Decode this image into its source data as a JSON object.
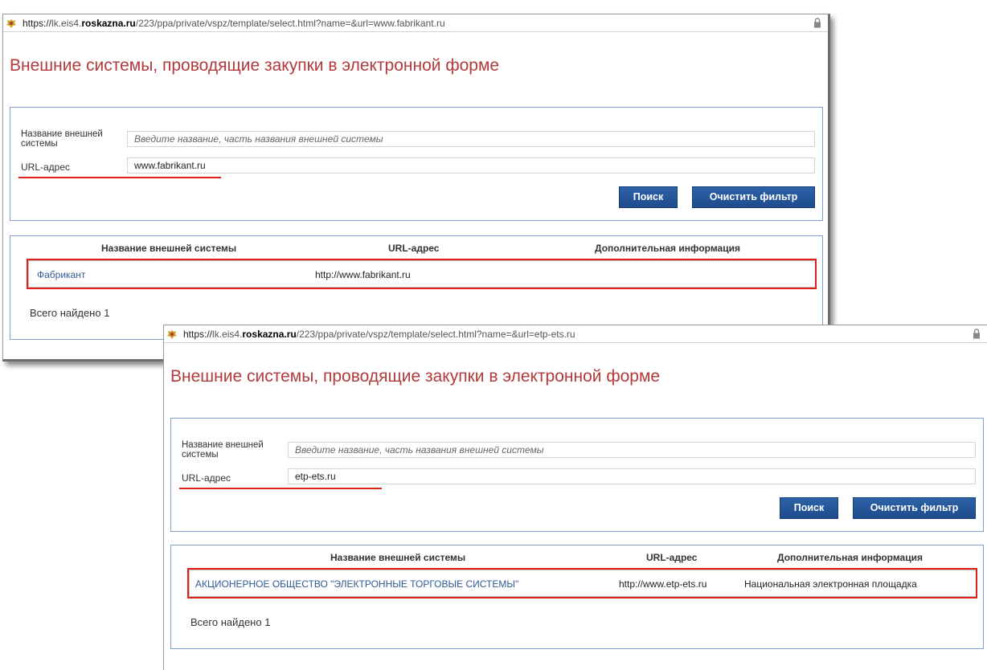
{
  "win1": {
    "url": {
      "proto": "https://",
      "pre_host": "lk.eis4.",
      "host": "roskazna.ru",
      "path": "/223/ppa/private/vspz/template/select.html?name=&url=www.fabrikant.ru"
    },
    "title": "Внешние системы, проводящие закупки в электронной форме",
    "filter": {
      "name_label": "Название внешней системы",
      "name_placeholder": "Введите название, часть названия внешней системы",
      "url_label": "URL-адрес",
      "url_value": "www.fabrikant.ru",
      "search_label": "Поиск",
      "clear_label": "Очистить фильтр"
    },
    "table": {
      "headers": [
        "Название внешней системы",
        "URL-адрес",
        "Дополнительная информация"
      ],
      "rows": [
        {
          "name": "Фабрикант",
          "url": "http://www.fabrikant.ru",
          "info": ""
        }
      ]
    },
    "total": "Всего найдено 1"
  },
  "win2": {
    "url": {
      "proto": "https://",
      "pre_host": "lk.eis4.",
      "host": "roskazna.ru",
      "path": "/223/ppa/private/vspz/template/select.html?name=&url=etp-ets.ru"
    },
    "title": "Внешние системы, проводящие закупки в электронной форме",
    "filter": {
      "name_label": "Название внешней системы",
      "name_placeholder": "Введите название, часть названия внешней системы",
      "url_label": "URL-адрес",
      "url_value": "etp-ets.ru",
      "search_label": "Поиск",
      "clear_label": "Очистить фильтр"
    },
    "table": {
      "headers": [
        "Название внешней системы",
        "URL-адрес",
        "Дополнительная информация"
      ],
      "rows": [
        {
          "name": "АКЦИОНЕРНОЕ ОБЩЕСТВО \"ЭЛЕКТРОННЫЕ ТОРГОВЫЕ СИСТЕМЫ\"",
          "url": "http://www.etp-ets.ru",
          "info": "Национальная электронная площадка"
        }
      ]
    },
    "total": "Всего найдено 1"
  },
  "colors": {
    "title": "#b23a3a",
    "button": "#1e4c8c",
    "link": "#2f5a95",
    "highlight": "#e0201a",
    "box_border": "#7e9fc9"
  },
  "icons": {
    "site": "emblem-icon",
    "lock": "lock-icon"
  }
}
